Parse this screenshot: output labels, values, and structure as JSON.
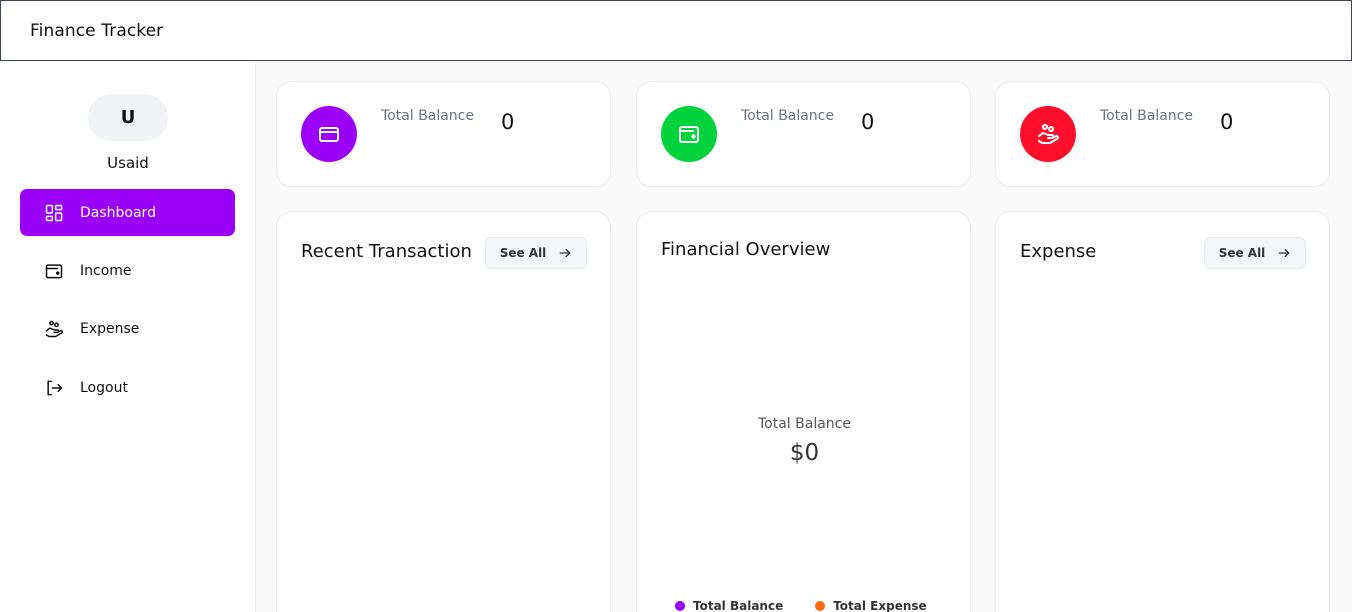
{
  "app": {
    "title": "Finance Tracker"
  },
  "user": {
    "initial": "U",
    "name": "Usaid"
  },
  "sidebar": {
    "items": [
      {
        "label": "Dashboard",
        "icon": "dashboard-grid-icon",
        "active": true
      },
      {
        "label": "Income",
        "icon": "wallet-icon",
        "active": false
      },
      {
        "label": "Expense",
        "icon": "hand-coins-icon",
        "active": false
      },
      {
        "label": "Logout",
        "icon": "logout-icon",
        "active": false
      }
    ]
  },
  "stats": [
    {
      "label": "Total Balance",
      "value": "0",
      "icon": "credit-card-icon",
      "color": "#9b00f7"
    },
    {
      "label": "Total Balance",
      "value": "0",
      "icon": "wallet-icon",
      "color": "#00d33c"
    },
    {
      "label": "Total Balance",
      "value": "0",
      "icon": "hand-coins-icon",
      "color": "#ff0f2b"
    }
  ],
  "panels": {
    "recent": {
      "title": "Recent Transaction",
      "see_all": "See All"
    },
    "overview": {
      "title": "Financial Overview",
      "caption": "Total Balance",
      "value": "$0",
      "legend": [
        {
          "label": "Total Balance",
          "color": "#9b00f7"
        },
        {
          "label": "Total Expense",
          "color": "#fa6a0a"
        }
      ]
    },
    "expense": {
      "title": "Expense",
      "see_all": "See All"
    }
  },
  "colors": {
    "accent": "#9b00f7",
    "income": "#00d33c",
    "expense": "#ff0f2b"
  }
}
